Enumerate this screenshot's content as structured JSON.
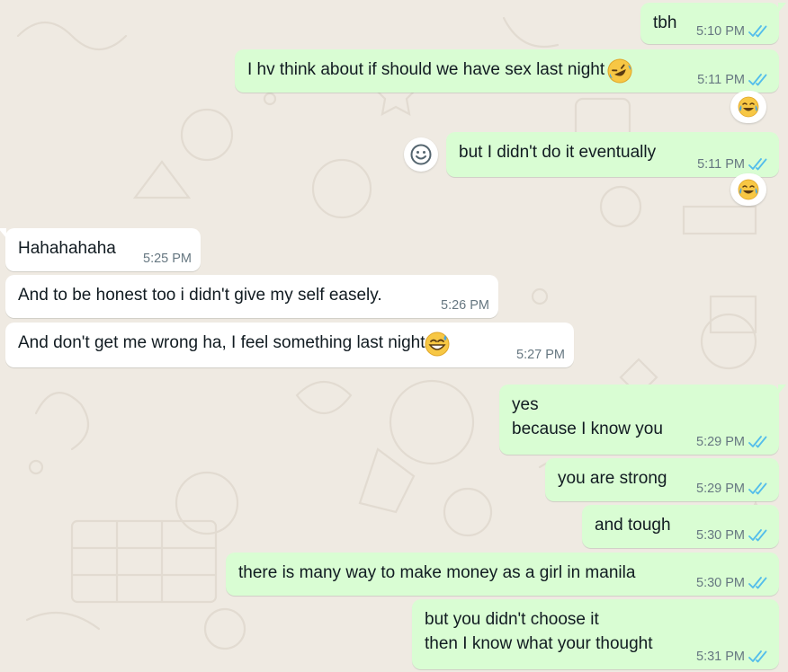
{
  "messages": [
    {
      "id": "m1",
      "direction": "outgoing",
      "text": "tbh",
      "time": "5:10 PM",
      "status": "read"
    },
    {
      "id": "m2",
      "direction": "outgoing",
      "text": "I hv think about if should we have sex last night",
      "inline_emoji": "rolling-on-floor-laughing",
      "time": "5:11 PM",
      "status": "read",
      "reaction": "face-with-tears-of-joy"
    },
    {
      "id": "m3",
      "direction": "outgoing",
      "text": "but I didn't do it eventually",
      "time": "5:11 PM",
      "status": "read",
      "reaction": "face-with-tears-of-joy"
    },
    {
      "id": "m4",
      "direction": "incoming",
      "text": "Hahahahaha",
      "time": "5:25 PM"
    },
    {
      "id": "m5",
      "direction": "incoming",
      "text": "And to be honest too i didn't give my self easely.",
      "time": "5:26 PM"
    },
    {
      "id": "m6",
      "direction": "incoming",
      "text": "And don't get me wrong ha, I feel something last night",
      "inline_emoji": "grinning-face-with-sweat",
      "time": "5:27 PM"
    },
    {
      "id": "m7",
      "direction": "outgoing",
      "text": "yes\nbecause I know you",
      "time": "5:29 PM",
      "status": "read"
    },
    {
      "id": "m8",
      "direction": "outgoing",
      "text": "you are strong",
      "time": "5:29 PM",
      "status": "read"
    },
    {
      "id": "m9",
      "direction": "outgoing",
      "text": "and tough",
      "time": "5:30 PM",
      "status": "read"
    },
    {
      "id": "m10",
      "direction": "outgoing",
      "text": "there is many way to make money as a girl in manila",
      "time": "5:30 PM",
      "status": "read"
    },
    {
      "id": "m11",
      "direction": "outgoing",
      "text": "but you didn't choose it\nthen I know what your thought",
      "time": "5:31 PM",
      "status": "read"
    }
  ],
  "colors": {
    "background": "#efeae2",
    "outgoing_bubble": "#d9fdd3",
    "incoming_bubble": "#ffffff",
    "read_tick": "#53bdeb",
    "timestamp": "#667781"
  },
  "icons": {
    "read_receipt": "double-check-icon",
    "react_button": "smiley-icon"
  }
}
